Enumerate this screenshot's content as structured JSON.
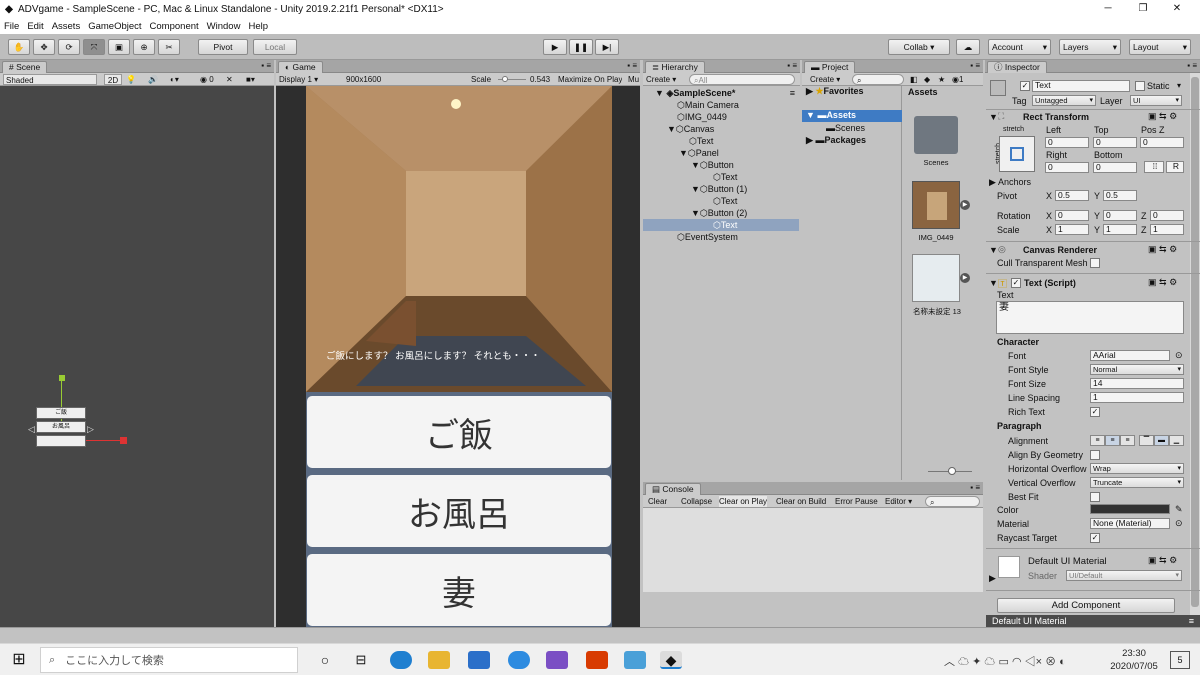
{
  "window": {
    "title": "ADVgame - SampleScene - PC, Mac & Linux Standalone - Unity 2019.2.21f1 Personal* <DX11>",
    "minimize": "─",
    "maximize": "❐",
    "close": "✕"
  },
  "menu": [
    "File",
    "Edit",
    "Assets",
    "GameObject",
    "Component",
    "Window",
    "Help"
  ],
  "toolbar": {
    "pivot": "Pivot",
    "local": "Local",
    "collab": "Collab ▾",
    "account": "Account",
    "layers": "Layers",
    "layout": "Layout"
  },
  "scene": {
    "tab": "Scene",
    "shading": "Shaded",
    "mode2d": "2D",
    "gizmo_count": "0",
    "mini_button1": "ご飯",
    "mini_button2": "お風呂"
  },
  "game": {
    "tab": "Game",
    "display": "Display 1",
    "resolution": "900x1600",
    "scale_label": "Scale",
    "scale_value": "0.543",
    "maximize": "Maximize On Play",
    "mute": "Mu",
    "dialog": "ご飯にします？ お風呂にします？ それとも・・・",
    "buttons": [
      "ご飯",
      "お風呂",
      "妻"
    ]
  },
  "hierarchy": {
    "tab": "Hierarchy",
    "create": "Create",
    "search_placeholder": "All",
    "items": [
      {
        "label": "SampleScene*"
      },
      {
        "label": "Main Camera"
      },
      {
        "label": "IMG_0449"
      },
      {
        "label": "Canvas"
      },
      {
        "label": "Text"
      },
      {
        "label": "Panel"
      },
      {
        "label": "Button"
      },
      {
        "label": "Text"
      },
      {
        "label": "Button (1)"
      },
      {
        "label": "Text"
      },
      {
        "label": "Button (2)"
      },
      {
        "label": "Text"
      },
      {
        "label": "EventSystem"
      }
    ]
  },
  "project": {
    "tab": "Project",
    "create": "Create",
    "favorites": "Favorites",
    "assets": "Assets",
    "scenes": "Scenes",
    "packages": "Packages",
    "assets_header": "Assets",
    "items": [
      {
        "label": "Scenes"
      },
      {
        "label": "IMG_0449"
      },
      {
        "label": "名称未設定 13"
      }
    ],
    "count": "1"
  },
  "console": {
    "tab": "Console",
    "buttons": [
      "Clear",
      "Collapse",
      "Clear on Play",
      "Clear on Build",
      "Error Pause",
      "Editor"
    ]
  },
  "inspector": {
    "tab": "Inspector",
    "object_name": "Text",
    "static": "Static",
    "tag_label": "Tag",
    "tag_value": "Untagged",
    "layer_label": "Layer",
    "layer_value": "UI",
    "rect_transform": {
      "title": "Rect Transform",
      "stretch_h": "stretch",
      "stretch_v": "stretch",
      "left": "Left",
      "top": "Top",
      "posz": "Pos Z",
      "left_v": "0",
      "top_v": "0",
      "posz_v": "0",
      "right": "Right",
      "bottom": "Bottom",
      "right_v": "0",
      "bottom_v": "0",
      "r_button": "R",
      "anchors": "Anchors",
      "pivot": "Pivot",
      "pivot_x": "0.5",
      "pivot_y": "0.5",
      "rotation": "Rotation",
      "rot_x": "0",
      "rot_y": "0",
      "rot_z": "0",
      "scale": "Scale",
      "scale_x": "1",
      "scale_y": "1",
      "scale_z": "1",
      "x": "X",
      "y": "Y",
      "z": "Z"
    },
    "canvas_renderer": {
      "title": "Canvas Renderer",
      "cull": "Cull Transparent Mesh"
    },
    "text_script": {
      "title": "Text (Script)",
      "text_label": "Text",
      "text_value": "妻",
      "character": "Character",
      "font": "Font",
      "font_value": "Arial",
      "font_style": "Font Style",
      "font_style_value": "Normal",
      "font_size": "Font Size",
      "font_size_value": "14",
      "line_spacing": "Line Spacing",
      "line_spacing_value": "1",
      "rich_text": "Rich Text",
      "paragraph": "Paragraph",
      "alignment": "Alignment",
      "align_geometry": "Align By Geometry",
      "h_overflow": "Horizontal Overflow",
      "h_overflow_value": "Wrap",
      "v_overflow": "Vertical Overflow",
      "v_overflow_value": "Truncate",
      "best_fit": "Best Fit",
      "color": "Color",
      "material": "Material",
      "material_value": "None (Material)",
      "raycast": "Raycast Target"
    },
    "material_section": {
      "title": "Default UI Material",
      "shader": "Shader",
      "shader_value": "UI/Default"
    },
    "add_component": "Add Component",
    "footer": "Default UI Material"
  },
  "taskbar": {
    "search_placeholder": "ここに入力して検索",
    "time": "23:30",
    "date": "2020/07/05",
    "notifications": "5"
  },
  "colors": {
    "unity_bg": "#c2c2c2",
    "selection": "#3e7bc4",
    "scene_bg": "#474747",
    "game_bg": "#2e2e2e"
  }
}
